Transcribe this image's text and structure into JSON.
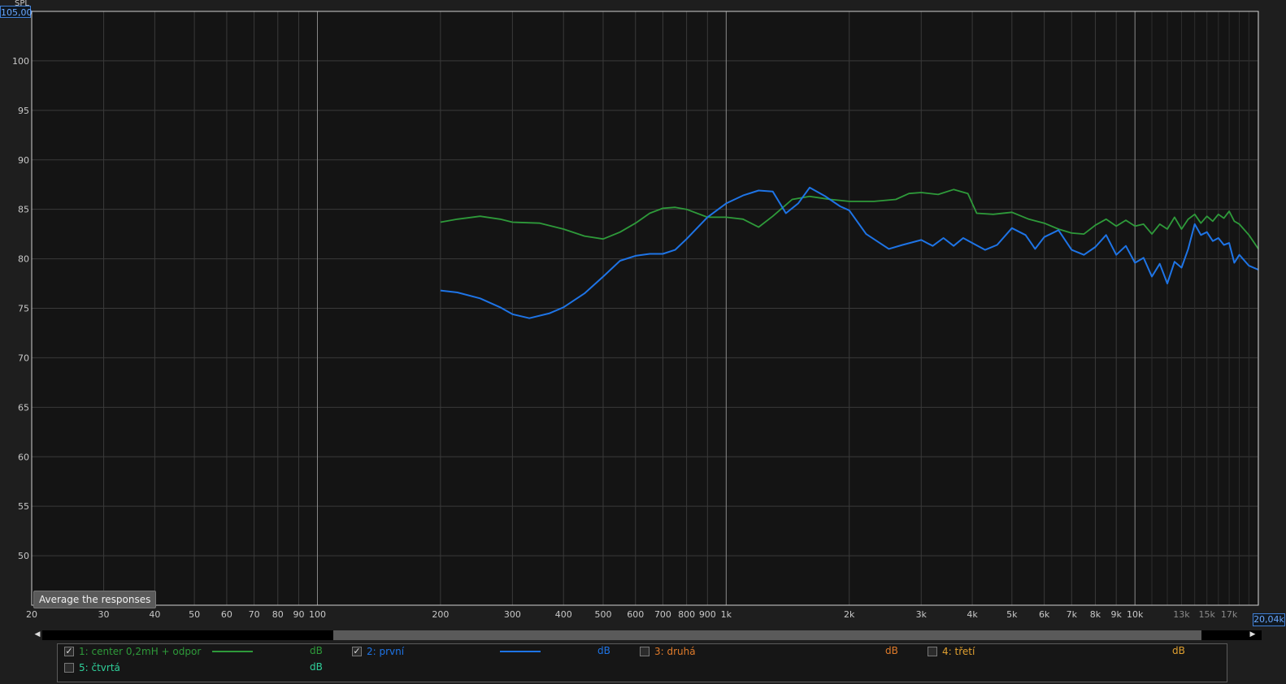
{
  "y_axis": {
    "label": "SPL",
    "max_box": "105,00",
    "ticks": [
      "100",
      "95",
      "90",
      "85",
      "80",
      "75",
      "70",
      "65",
      "60",
      "55",
      "50"
    ]
  },
  "x_axis": {
    "max_box": "20,04k",
    "ticks": [
      "20",
      "30",
      "40",
      "50",
      "60",
      "70",
      "80",
      "90",
      "100",
      "200",
      "300",
      "400",
      "500",
      "600",
      "700",
      "800",
      "900",
      "1k",
      "2k",
      "3k",
      "4k",
      "5k",
      "6k",
      "7k",
      "8k",
      "9k",
      "10k",
      "13k",
      "15k",
      "17k"
    ]
  },
  "controls": {
    "average_button": "Average the responses"
  },
  "legend": [
    {
      "label": "1: center 0,2mH + odpor",
      "checked": true,
      "color": "#2e9a3a",
      "unit": "dB"
    },
    {
      "label": "2: první",
      "checked": true,
      "color": "#1e74e6",
      "unit": "dB"
    },
    {
      "label": "3: druhá",
      "checked": false,
      "color": "#e07b2a",
      "unit": "dB"
    },
    {
      "label": "4: třetí",
      "checked": false,
      "color": "#e0a030",
      "unit": "dB"
    },
    {
      "label": "5: čtvrtá",
      "checked": false,
      "color": "#2fcf9a",
      "unit": "dB"
    }
  ],
  "chart_data": {
    "type": "line",
    "x_scale": "log",
    "xlim": [
      20,
      20040
    ],
    "ylim": [
      45,
      105
    ],
    "grid": true,
    "ylabel": "SPL",
    "series": [
      {
        "name": "1: center 0,2mH + odpor",
        "color": "#2e9a3a",
        "points": [
          [
            200,
            83.7
          ],
          [
            220,
            84.0
          ],
          [
            250,
            84.3
          ],
          [
            280,
            84.0
          ],
          [
            300,
            83.7
          ],
          [
            350,
            83.6
          ],
          [
            400,
            83.0
          ],
          [
            450,
            82.3
          ],
          [
            500,
            82.0
          ],
          [
            550,
            82.7
          ],
          [
            600,
            83.6
          ],
          [
            650,
            84.6
          ],
          [
            700,
            85.1
          ],
          [
            750,
            85.2
          ],
          [
            800,
            85.0
          ],
          [
            900,
            84.2
          ],
          [
            1000,
            84.2
          ],
          [
            1100,
            84.0
          ],
          [
            1200,
            83.2
          ],
          [
            1300,
            84.3
          ],
          [
            1450,
            86.0
          ],
          [
            1600,
            86.3
          ],
          [
            1800,
            86.0
          ],
          [
            2000,
            85.8
          ],
          [
            2300,
            85.8
          ],
          [
            2600,
            86.0
          ],
          [
            2800,
            86.6
          ],
          [
            3000,
            86.7
          ],
          [
            3300,
            86.5
          ],
          [
            3600,
            87.0
          ],
          [
            3900,
            86.6
          ],
          [
            4100,
            84.6
          ],
          [
            4500,
            84.5
          ],
          [
            5000,
            84.7
          ],
          [
            5500,
            84.0
          ],
          [
            6000,
            83.6
          ],
          [
            6500,
            83.0
          ],
          [
            7000,
            82.6
          ],
          [
            7500,
            82.5
          ],
          [
            8000,
            83.4
          ],
          [
            8500,
            84.0
          ],
          [
            9000,
            83.3
          ],
          [
            9500,
            83.9
          ],
          [
            10000,
            83.3
          ],
          [
            10500,
            83.5
          ],
          [
            11000,
            82.5
          ],
          [
            11500,
            83.5
          ],
          [
            12000,
            83.0
          ],
          [
            12500,
            84.2
          ],
          [
            13000,
            83.0
          ],
          [
            13500,
            84.0
          ],
          [
            14000,
            84.5
          ],
          [
            14500,
            83.6
          ],
          [
            15000,
            84.3
          ],
          [
            15500,
            83.8
          ],
          [
            16000,
            84.5
          ],
          [
            16500,
            84.1
          ],
          [
            17000,
            84.8
          ],
          [
            17500,
            83.8
          ],
          [
            18000,
            83.5
          ],
          [
            19000,
            82.4
          ],
          [
            20040,
            81.0
          ]
        ]
      },
      {
        "name": "2: první",
        "color": "#1e74e6",
        "points": [
          [
            200,
            76.8
          ],
          [
            220,
            76.6
          ],
          [
            250,
            76.0
          ],
          [
            280,
            75.1
          ],
          [
            300,
            74.4
          ],
          [
            330,
            74.0
          ],
          [
            370,
            74.5
          ],
          [
            400,
            75.1
          ],
          [
            450,
            76.5
          ],
          [
            500,
            78.2
          ],
          [
            550,
            79.8
          ],
          [
            600,
            80.3
          ],
          [
            650,
            80.5
          ],
          [
            700,
            80.5
          ],
          [
            750,
            80.9
          ],
          [
            800,
            82.0
          ],
          [
            900,
            84.2
          ],
          [
            1000,
            85.6
          ],
          [
            1100,
            86.4
          ],
          [
            1200,
            86.9
          ],
          [
            1300,
            86.8
          ],
          [
            1400,
            84.6
          ],
          [
            1500,
            85.6
          ],
          [
            1600,
            87.2
          ],
          [
            1750,
            86.3
          ],
          [
            1900,
            85.3
          ],
          [
            2000,
            84.9
          ],
          [
            2200,
            82.5
          ],
          [
            2500,
            81.0
          ],
          [
            2700,
            81.4
          ],
          [
            3000,
            81.9
          ],
          [
            3200,
            81.3
          ],
          [
            3400,
            82.1
          ],
          [
            3600,
            81.3
          ],
          [
            3800,
            82.1
          ],
          [
            4000,
            81.6
          ],
          [
            4300,
            80.9
          ],
          [
            4600,
            81.4
          ],
          [
            5000,
            83.1
          ],
          [
            5400,
            82.4
          ],
          [
            5700,
            81.0
          ],
          [
            6000,
            82.2
          ],
          [
            6500,
            82.9
          ],
          [
            7000,
            80.9
          ],
          [
            7500,
            80.4
          ],
          [
            8000,
            81.2
          ],
          [
            8500,
            82.4
          ],
          [
            9000,
            80.4
          ],
          [
            9500,
            81.3
          ],
          [
            10000,
            79.6
          ],
          [
            10500,
            80.1
          ],
          [
            11000,
            78.2
          ],
          [
            11500,
            79.5
          ],
          [
            12000,
            77.5
          ],
          [
            12500,
            79.7
          ],
          [
            13000,
            79.1
          ],
          [
            13500,
            81.0
          ],
          [
            14000,
            83.5
          ],
          [
            14500,
            82.4
          ],
          [
            15000,
            82.7
          ],
          [
            15500,
            81.8
          ],
          [
            16000,
            82.1
          ],
          [
            16500,
            81.4
          ],
          [
            17000,
            81.6
          ],
          [
            17500,
            79.6
          ],
          [
            18000,
            80.4
          ],
          [
            19000,
            79.3
          ],
          [
            20040,
            78.9
          ]
        ]
      }
    ]
  }
}
